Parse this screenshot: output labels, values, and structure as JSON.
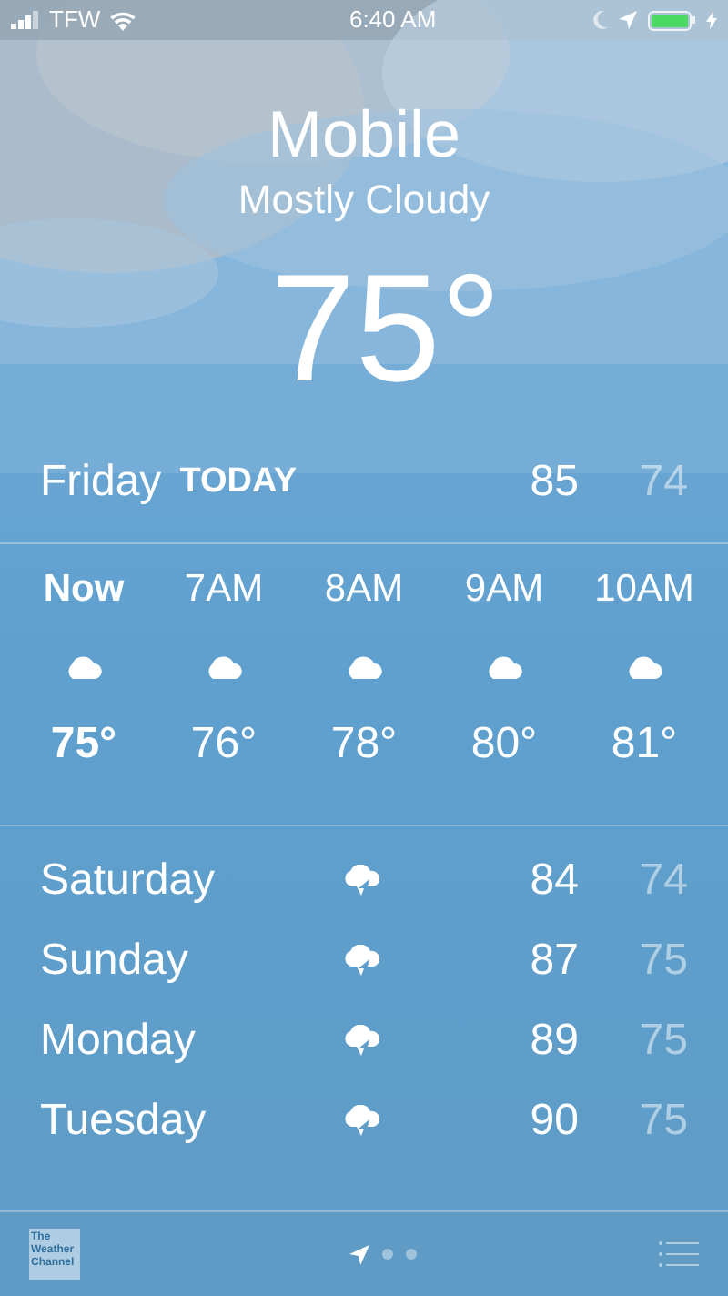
{
  "status_bar": {
    "carrier": "TFW",
    "time": "6:40 AM"
  },
  "location": {
    "city": "Mobile",
    "condition": "Mostly Cloudy",
    "temperature": "75°"
  },
  "today": {
    "day": "Friday",
    "label": "TODAY",
    "high": "85",
    "low": "74"
  },
  "hourly": [
    {
      "time": "Now",
      "temp": "75°",
      "selected": true
    },
    {
      "time": "7AM",
      "temp": "76°",
      "selected": false
    },
    {
      "time": "8AM",
      "temp": "78°",
      "selected": false
    },
    {
      "time": "9AM",
      "temp": "80°",
      "selected": false
    },
    {
      "time": "10AM",
      "temp": "81°",
      "selected": false
    }
  ],
  "daily": [
    {
      "day": "Saturday",
      "high": "84",
      "low": "74"
    },
    {
      "day": "Sunday",
      "high": "87",
      "low": "75"
    },
    {
      "day": "Monday",
      "high": "89",
      "low": "75"
    },
    {
      "day": "Tuesday",
      "high": "90",
      "low": "75"
    }
  ],
  "bottom_bar": {
    "logo": "The Weather Channel",
    "pages": [
      {
        "kind": "location",
        "selected": true
      },
      {
        "kind": "dot",
        "selected": false
      },
      {
        "kind": "dot",
        "selected": false
      }
    ]
  }
}
